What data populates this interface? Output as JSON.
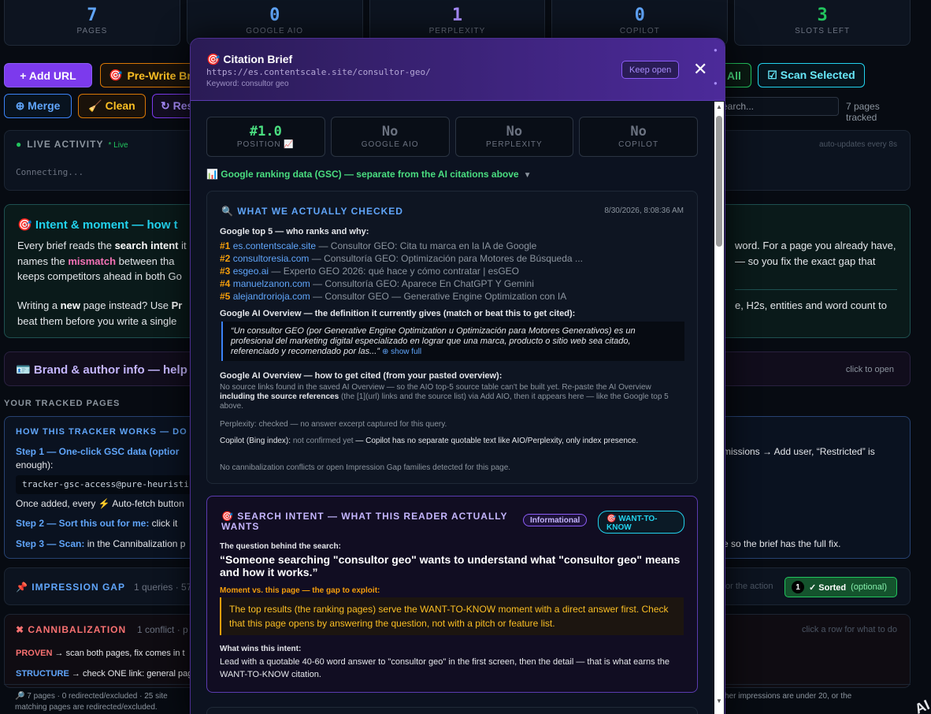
{
  "stats": [
    {
      "value": "7",
      "label": "PAGES",
      "color": "#60a5fa"
    },
    {
      "value": "0",
      "label": "GOOGLE AIO",
      "color": "#60a5fa"
    },
    {
      "value": "1",
      "label": "PERPLEXITY",
      "color": "#a78bfa"
    },
    {
      "value": "0",
      "label": "COPILOT",
      "color": "#60a5fa"
    },
    {
      "value": "3",
      "label": "SLOTS LEFT",
      "color": "#22c55e"
    }
  ],
  "toolbar": {
    "add_url": "+ Add URL",
    "pre_write": "Pre-Write Br",
    "all": "All",
    "scan_selected": "☑ Scan Selected",
    "merge": "⊕ Merge",
    "clean": "🧹 Clean",
    "res": "↻ Res",
    "search_placeholder": "earch...",
    "tracked": "7 pages tracked"
  },
  "live": {
    "title": "LIVE ACTIVITY",
    "tag": "* Live",
    "auto": "auto-updates every 8s",
    "status": "Connecting..."
  },
  "intent_panel": {
    "title": "Intent & moment — how t",
    "p1_a": "Every brief reads the ",
    "p1_b": "search intent",
    "p1_c": " it names the ",
    "p1_d": "mismatch",
    "p1_e": " between tha keeps competitors ahead in both Go",
    "p2_a": "Writing a ",
    "p2_b": "new",
    "p2_c": " page instead? Use ",
    "p2_d": "Pr",
    "p2_e": " beat them before you write a single",
    "r1": "word. For a page you already have, — so you fix the exact gap that",
    "r2": "e, H2s, entities and word count to"
  },
  "brand": {
    "title": "Brand & author info — help",
    "open": "click to open"
  },
  "tracked_title": "YOUR TRACKED PAGES",
  "how": {
    "title": "HOW THIS TRACKER WORKS — DO T",
    "s1_b": "Step 1 — One-click GSC data (optior",
    "s1_rest": " enough):",
    "code": "tracker-gsc-access@pure-heuristic-4",
    "s2": "Once added, every ⚡ Auto-fetch button",
    "s3_b": "Step 2 — Sort this out for me:",
    "s3_rest": " click it",
    "s4_b": "Step 3 — Scan:",
    "s4_rest": " in the Cannibalization p",
    "r1": "missions → Add user, “Restricted” is",
    "r2": "e so the brief has the full fix."
  },
  "impression": {
    "title": "IMPRESSION GAP",
    "sub": "1 queries · 57",
    "action": "or the action",
    "sorted_n": "1",
    "sorted_label": "✓ Sorted",
    "sorted_opt": "(optional)"
  },
  "cannibalization": {
    "title": "CANNIBALIZATION",
    "sub": "1 conflict · p",
    "hint": "click a row for what to do",
    "l1_b": "PROVEN",
    "l1_rest": " → scan both pages, fix comes in t",
    "l2_b": "STRUCTURE",
    "l2_rest": " → check ONE link: general pag"
  },
  "footer": {
    "left": "🔎 7 pages · 0 redirected/excluded · 25 site matching pages are redirected/excluded.",
    "right": "her impressions are under 20, or the",
    "corner": "AI"
  },
  "modal": {
    "title": "Citation Brief",
    "url": "https://es.contentscale.site/consultor-geo/",
    "keyword": "Keyword: consultor geo",
    "keep_open": "Keep open",
    "close": "✕",
    "metrics": [
      {
        "value": "#1.0",
        "label": "POSITION 📈",
        "positive": true
      },
      {
        "value": "No",
        "label": "GOOGLE AIO",
        "positive": false
      },
      {
        "value": "No",
        "label": "PERPLEXITY",
        "positive": false
      },
      {
        "value": "No",
        "label": "COPILOT",
        "positive": false
      }
    ],
    "gsc_toggle": "Google ranking data (GSC) — separate from the AI citations above",
    "checked": {
      "title": "WHAT WE ACTUALLY CHECKED",
      "date": "8/30/2026, 8:08:36 AM",
      "top5_label": "Google top 5 — who ranks and why:",
      "results": [
        {
          "rank": "#1",
          "domain": "es.contentscale.site",
          "title": " — Consultor GEO: Cita tu marca en la IA de Google"
        },
        {
          "rank": "#2",
          "domain": "consultoresia.com",
          "title": " — Consultoría GEO: Optimización para Motores de Búsqueda ..."
        },
        {
          "rank": "#3",
          "domain": "esgeo.ai",
          "title": " — Experto GEO 2026: qué hace y cómo contratar | esGEO"
        },
        {
          "rank": "#4",
          "domain": "manuelzanon.com",
          "title": " — Consultoría GEO: Aparece En ChatGPT Y Gemini"
        },
        {
          "rank": "#5",
          "domain": "alejandrorioja.com",
          "title": " — Consultor GEO — Generative Engine Optimization con IA"
        }
      ],
      "aio_def_label": "Google AI Overview — the definition it currently gives (match or beat this to get cited):",
      "aio_quote": "“Un consultor GEO (por Generative Engine Optimization u Optimización para Motores Generativos) es un profesional del marketing digital especializado en lograr que una marca, producto o sitio web sea citado, referenciado y recomendado por las...”",
      "show_full": "⊕ show full",
      "aio_cite_label": "Google AI Overview — how to get cited (from your pasted overview):",
      "nosrc_a": "No source links found in the saved AI Overview — so the AIO top-5 source table can't be built yet. Re-paste the AI Overview ",
      "nosrc_b": "including the source references",
      "nosrc_c": " (the [1](url) links and the source list) via Add AIO, then it appears here — like the Google top 5 above.",
      "perplexity": "Perplexity: checked — no answer excerpt captured for this query.",
      "copilot_a": "Copilot (Bing index): ",
      "copilot_b": "not confirmed yet",
      "copilot_c": " — Copilot has no separate quotable text like AIO/Perplexity, only index presence.",
      "no_cann": "No cannibalization conflicts or open Impression Gap families detected for this page."
    },
    "search_intent": {
      "title": "SEARCH INTENT — WHAT THIS READER ACTUALLY WANTS",
      "badge1": "Informational",
      "badge2": "WANT-TO-KNOW",
      "question_label": "The question behind the search:",
      "question": "“Someone searching \"consultor geo\" wants to understand what \"consultor geo\" means and how it works.”",
      "moment_label": "Moment vs. this page — the gap to exploit:",
      "gap": "The top results (the ranking pages) serve the WANT-TO-KNOW moment with a direct answer first. Check that this page opens by answering the question, not with a pitch or feature list.",
      "wins_label": "What wins this intent:",
      "wins": "Lead with a quotable 40-60 word answer to \"consultor geo\" in the first screen, then the detail — that is what earns the WANT-TO-KNOW citation."
    }
  }
}
